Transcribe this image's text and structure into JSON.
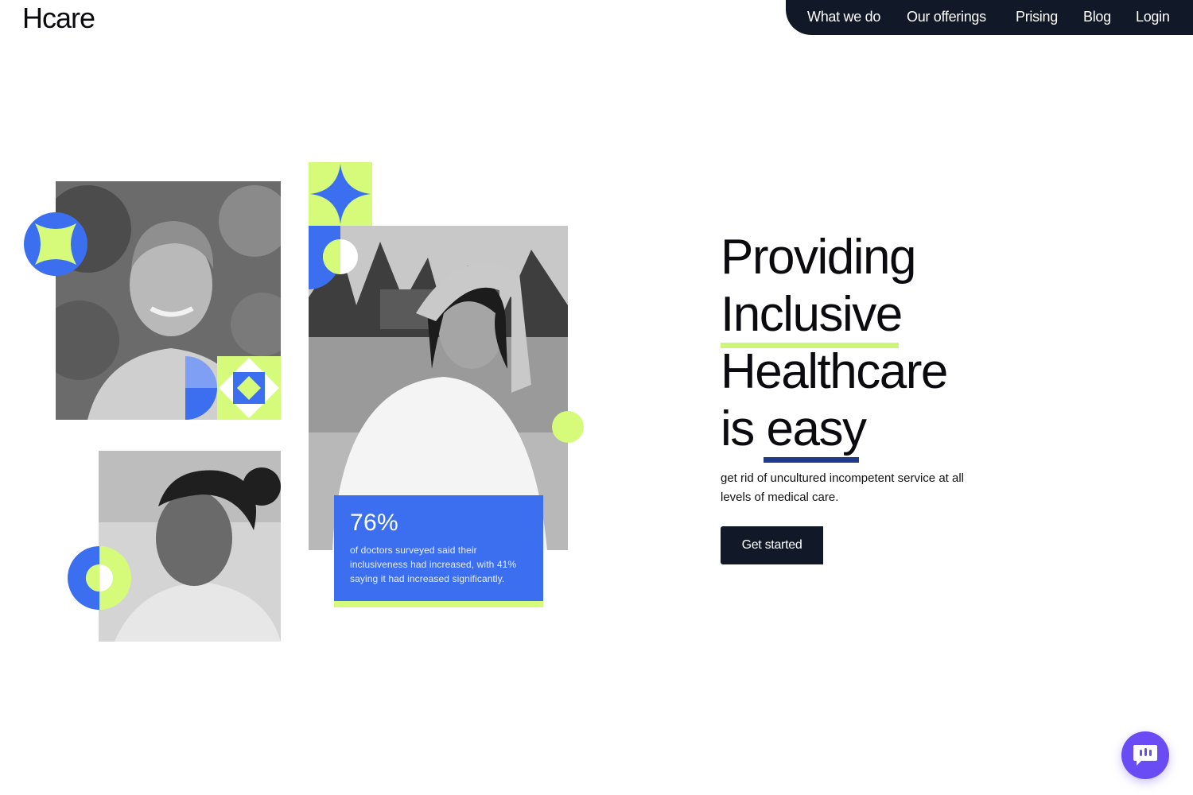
{
  "brand": {
    "logo_text": "Hcare"
  },
  "nav": {
    "items": [
      {
        "label": "What we do"
      },
      {
        "label": "Our offerings"
      },
      {
        "label": "Prising"
      },
      {
        "label": "Blog"
      },
      {
        "label": "Login"
      }
    ]
  },
  "hero": {
    "headline_lines": [
      "Providing",
      "Inclusive",
      "Healthcare",
      "is easy"
    ],
    "headline_line4_prefix": "is ",
    "headline_line4_highlight": "easy",
    "subtext": "get rid of uncultured incompetent service at all levels of medical care.",
    "cta_label": "Get started"
  },
  "stat_card": {
    "value": "76%",
    "description": "of doctors surveyed said their inclusiveness had increased, with 41% saying it had increased significantly."
  },
  "colors": {
    "blue": "#3b6ff0",
    "lime": "#d6fb7a",
    "navy": "#111827",
    "underline_navy": "#1f3a8a",
    "chat": "#6a4cf5"
  },
  "icons": {
    "chat": "chat-bubble-icon",
    "sparkle": "four-point-star-icon"
  }
}
